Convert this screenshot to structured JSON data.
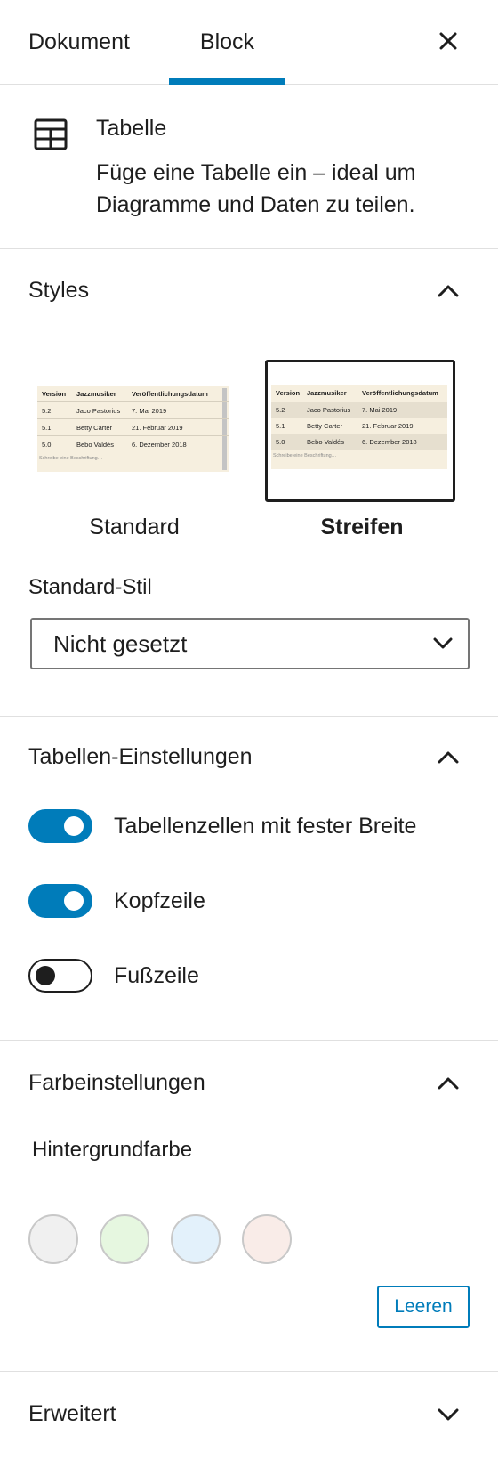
{
  "tabs": {
    "document": "Dokument",
    "block": "Block"
  },
  "block_card": {
    "title": "Tabelle",
    "description": "Füge eine Tabelle ein – ideal um Diagramme und Daten zu teilen."
  },
  "styles_panel": {
    "title": "Styles",
    "preview_table": {
      "headers": [
        "Version",
        "Jazzmusiker",
        "Veröffentlichungsdatum"
      ],
      "rows": [
        [
          "5.2",
          "Jaco Pastorius",
          "7. Mai 2019"
        ],
        [
          "5.1",
          "Betty Carter",
          "21. Februar 2019"
        ],
        [
          "5.0",
          "Bebo Valdés",
          "6. Dezember 2018"
        ]
      ],
      "caption": "Schreibe eine Beschriftung…"
    },
    "options": [
      {
        "label": "Standard",
        "selected": false
      },
      {
        "label": "Streifen",
        "selected": true
      }
    ],
    "default_style_label": "Standard-Stil",
    "default_style_value": "Nicht gesetzt"
  },
  "table_settings": {
    "title": "Tabellen-Einstellungen",
    "toggles": [
      {
        "label": "Tabellenzellen mit fester Breite",
        "on": true
      },
      {
        "label": "Kopfzeile",
        "on": true
      },
      {
        "label": "Fußzeile",
        "on": false
      }
    ]
  },
  "color_settings": {
    "title": "Farbeinstellungen",
    "background_label": "Hintergrundfarbe",
    "swatches": [
      "#f0f0f0",
      "#e6f7e0",
      "#e3f1fb",
      "#f9ece8"
    ],
    "clear_label": "Leeren"
  },
  "advanced": {
    "title": "Erweitert"
  },
  "colors": {
    "accent": "#007cba",
    "text": "#1e1e1e",
    "table_bg": "#f6efdf",
    "stripe": "#e6dfcf"
  }
}
